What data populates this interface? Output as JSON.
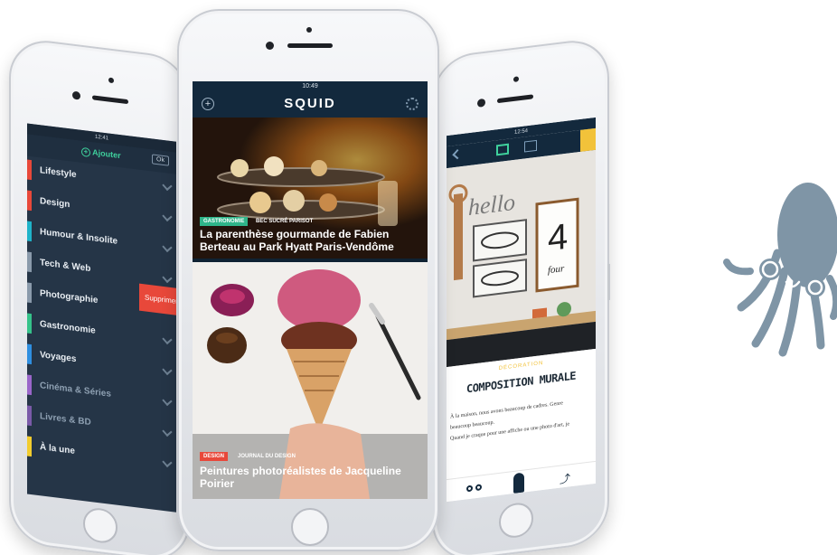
{
  "left_phone": {
    "status_time": "12:41",
    "add_label": "Ajouter",
    "ok_label": "Ok",
    "delete_label": "Supprimer",
    "categories": [
      {
        "label": "Lifestyle",
        "color": "#e8483a",
        "dim": false
      },
      {
        "label": "Design",
        "color": "#e8483a",
        "dim": false
      },
      {
        "label": "Humour & Insolite",
        "color": "#1fb3c9",
        "dim": false
      },
      {
        "label": "Tech & Web",
        "color": "#8a9aab",
        "dim": false
      },
      {
        "label": "Photographie",
        "color": "#8a9aab",
        "dim": false
      },
      {
        "label": "Gastronomie",
        "color": "#35c28a",
        "dim": false
      },
      {
        "label": "Voyages",
        "color": "#2f8fe0",
        "dim": false
      },
      {
        "label": "Cinéma & Séries",
        "color": "#9a66c9",
        "dim": true
      },
      {
        "label": "Livres & BD",
        "color": "#7a5aa8",
        "dim": true
      },
      {
        "label": "À la une",
        "color": "#f2cc2e",
        "dim": false
      }
    ]
  },
  "middle_phone": {
    "status_time": "10:49",
    "app_title": "SQUID",
    "articles": [
      {
        "tag_category": "GASTRONOMIE",
        "tag_source": "BEC SUCRÉ PARISOT",
        "tag_color": "#2fb58a",
        "title": "La parenthèse gourmande de Fabien Berteau au Park Hyatt Paris-Vendôme"
      },
      {
        "tag_category": "DESIGN",
        "tag_source": "JOURNAL DU DESIGN",
        "tag_color": "#e8483a",
        "title": "Peintures photoréalistes de Jacqueline Poirier"
      }
    ]
  },
  "right_phone": {
    "status_time": "12:54",
    "sign_text": "hello",
    "poster_number": "4",
    "poster_word": "four",
    "article_category": "DÉCORATION",
    "article_title": "COMPOSITION MURALE",
    "body_lines": [
      "À la maison, nous avons beaucoup de cadres. Genre",
      "beaucoup beaucoup.",
      "Quand je craque pour une affiche ou une photo d'art, je"
    ]
  },
  "colors": {
    "navy": "#13293d",
    "mascot": "#7f95a6",
    "accent_yellow": "#f2c23a"
  }
}
